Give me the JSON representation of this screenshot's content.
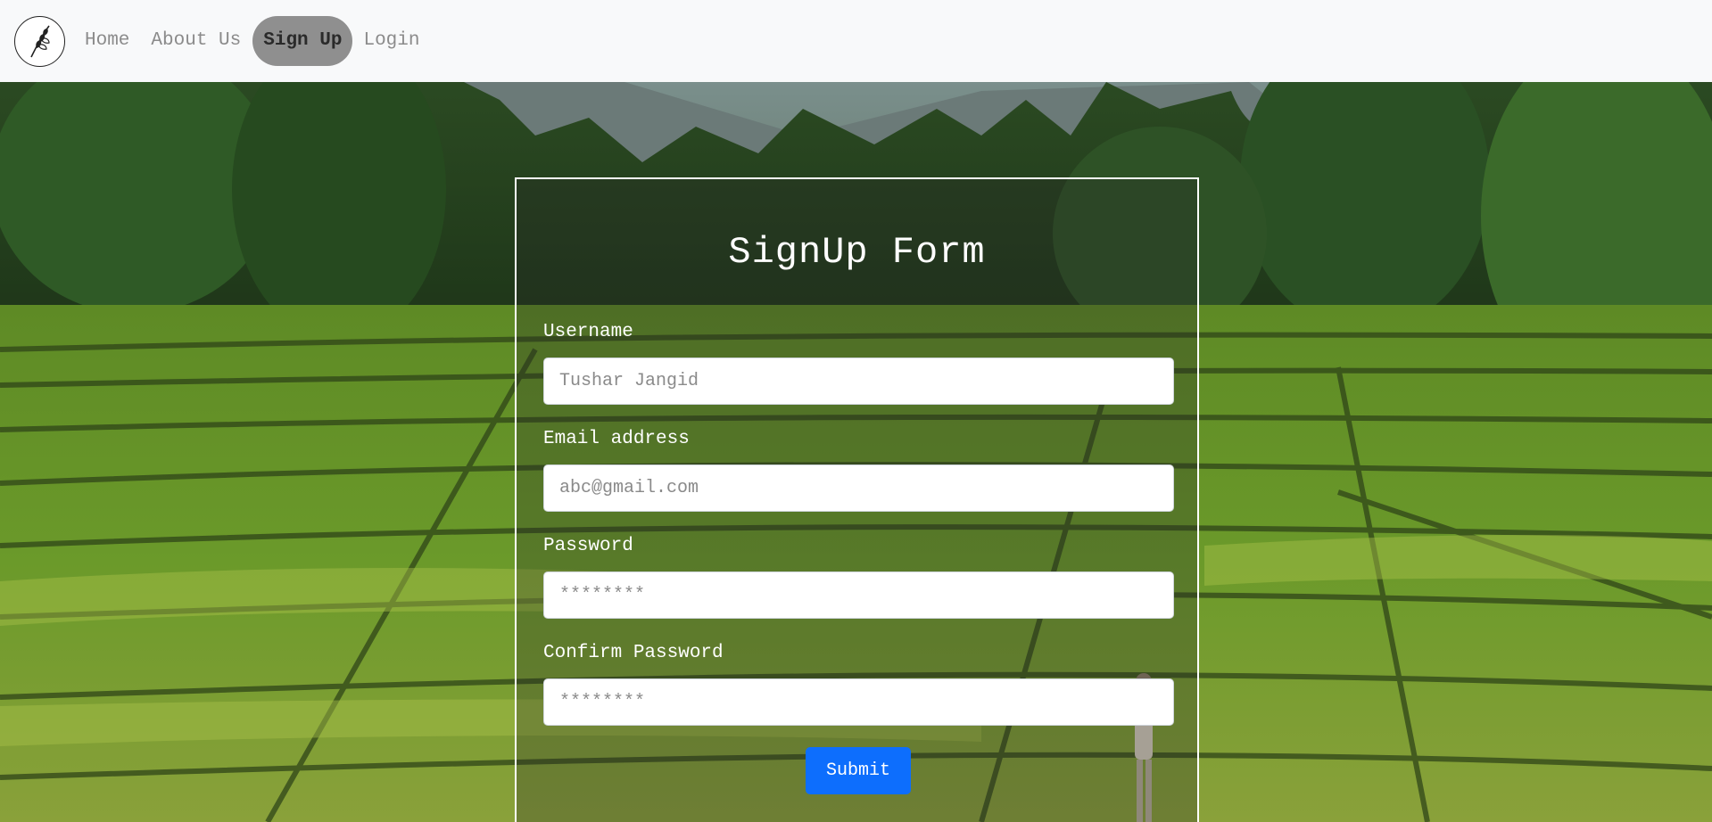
{
  "navbar": {
    "logo_icon": "wheat-leaf-icon",
    "links": [
      {
        "label": "Home",
        "active": false
      },
      {
        "label": "About Us",
        "active": false
      },
      {
        "label": "Sign Up",
        "active": true
      },
      {
        "label": "Login",
        "active": false
      }
    ]
  },
  "background": {
    "image": "rice-paddy-field-landscape",
    "description": ""
  },
  "form": {
    "title": "SignUp Form",
    "fields": [
      {
        "label": "Username",
        "placeholder": "Tushar Jangid",
        "type": "text"
      },
      {
        "label": "Email address",
        "placeholder": "abc@gmail.com",
        "type": "email"
      },
      {
        "label": "Password",
        "placeholder": "********",
        "type": "password"
      },
      {
        "label": "Confirm Password",
        "placeholder": "********",
        "type": "password"
      }
    ],
    "submit_label": "Submit"
  },
  "colors": {
    "navbar_bg": "#f8f9fa",
    "active_pill": "#8f8f8f",
    "submit_button": "#0d6efd",
    "card_border": "#ffffff"
  }
}
